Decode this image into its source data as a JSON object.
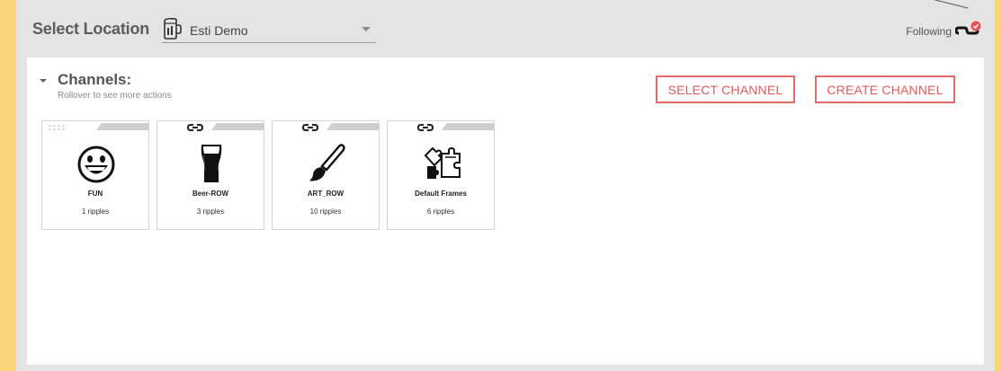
{
  "header": {
    "select_location_label": "Select Location",
    "location_value": "Esti Demo",
    "following_label": "Following"
  },
  "channels": {
    "title": "Channels:",
    "subtitle": "Rollover to see more actions",
    "select_button": "SELECT CHANNEL",
    "create_button": "CREATE CHANNEL",
    "tiles": [
      {
        "name": "FUN",
        "ripples": "1 ripples",
        "icon": "smiley-face-icon"
      },
      {
        "name": "Beer-ROW",
        "ripples": "3 ripples",
        "icon": "beer-glass-icon"
      },
      {
        "name": "ART_ROW",
        "ripples": "10 ripples",
        "icon": "paintbrush-icon"
      },
      {
        "name": "Default Frames",
        "ripples": "6 ripples",
        "icon": "puzzle-icon"
      }
    ]
  },
  "colors": {
    "background": "#fcd47c",
    "accent": "#e15a5a",
    "panel": "#ffffff",
    "frame": "#e4e4e4"
  }
}
